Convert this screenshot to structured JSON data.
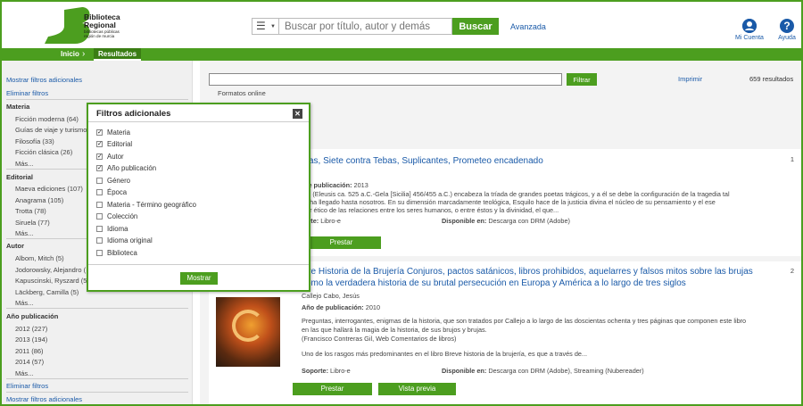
{
  "header": {
    "logo_title_1": "Biblioteca",
    "logo_title_2": "Regional",
    "logo_sub_1": "bibliotecas públicas",
    "logo_sub_2": "región de murcia",
    "search_placeholder": "Buscar por título, autor y demás",
    "search_button": "Buscar",
    "advanced_link": "Avanzada",
    "account_label": "Mi Cuenta",
    "help_label": "Ayuda"
  },
  "nav": {
    "home": "Inicio",
    "results": "Resultados"
  },
  "sidebar": {
    "more_filters_top": "Mostrar filtros adicionales",
    "remove_filters_top": "Eliminar filtros",
    "sections": [
      {
        "heading": "Materia",
        "items": [
          "Ficción moderna (64)",
          "Guías de viaje y turismo",
          "Filosofía (33)",
          "Ficción clásica (26)",
          "Más..."
        ]
      },
      {
        "heading": "Editorial",
        "items": [
          "Maeva ediciones (107)",
          "Anagrama (105)",
          "Trotta (78)",
          "Siruela (77)",
          "Más..."
        ]
      },
      {
        "heading": "Autor",
        "items": [
          "Albom, Mitch (5)",
          "Jodorowsky, Alejandro (",
          "Kapuscinski, Ryszard (5",
          "Läckberg, Camilla (5)",
          "Más..."
        ]
      },
      {
        "heading": "Año publicación",
        "items": [
          "2012 (227)",
          "2013 (194)",
          "2011 (86)",
          "2014 (57)",
          "Más..."
        ]
      }
    ],
    "remove_filters_bottom": "Eliminar filtros",
    "more_filters_bottom": "Mostrar filtros adicionales"
  },
  "main": {
    "filter_button": "Filtrar",
    "print_link": "Imprimir",
    "results_count": "659 resultados",
    "formats_label": "Formatos online",
    "results": [
      {
        "number": "1",
        "title": "sas, Siete contra Tebas, Suplicantes, Prometeo encadenado",
        "author": "ilo",
        "year_label": "de publicación:",
        "year": "2013",
        "desc_1": "ilo (Eleusis ca. 525 a.C.-Gela [Sicilia] 456/455 a.C.) encabeza la tríada de grandes poetas trágicos, y a él se debe la configuración de la tragedia tal",
        "desc_2": "a ha llegado hasta nosotros. En su dimensión marcadamente teológica, Esquilo hace de la justicia divina el núcleo de su pensamiento y el ese",
        "desc_3": "ter ético de las relaciones entre los seres humanos, o entre éstos y la divinidad, el que...",
        "support_label": "orte:",
        "support": "Libro-e",
        "avail_label": "Disponible en:",
        "avail": "Descarga con DRM (Adobe)",
        "borrow": "Prestar"
      },
      {
        "number": "2",
        "title_1": "eve Historia de la Brujería Conjuros, pactos satánicos, libros prohibidos, aquelarres y falsos mitos sobre las brujas",
        "title_2": "como la verdadera historia de su brutal persecución en Europa y América a lo largo de tres siglos",
        "author": "Callejo Cabo, Jesús",
        "year_label": "Año de publicación:",
        "year": "2010",
        "desc_1": "Preguntas, interrogantes, enigmas de la historia, que son tratados por Callejo a lo largo de las doscientas ochenta y tres páginas que componen este libro",
        "desc_2": "en las que hallará la magia de la historia, de sus brujos y brujas.",
        "desc_3": "(Francisco Contreras Gil, Web Comentarios de libros)",
        "desc_4": "Uno de los rasgos más predominantes en el libro Breve historia de la brujería, es que a través de...",
        "support_label": "Soporte:",
        "support": "Libro-e",
        "avail_label": "Disponible en:",
        "avail": "Descarga con DRM (Adobe), Streaming (Nubereader)",
        "borrow": "Prestar",
        "preview": "Vista previa"
      }
    ]
  },
  "modal": {
    "title": "Filtros adicionales",
    "close": "✕",
    "options": [
      {
        "label": "Materia",
        "checked": true
      },
      {
        "label": "Editorial",
        "checked": true
      },
      {
        "label": "Autor",
        "checked": true
      },
      {
        "label": "Año publicación",
        "checked": true
      },
      {
        "label": "Género",
        "checked": false
      },
      {
        "label": "Época",
        "checked": false
      },
      {
        "label": "Materia - Término geográfico",
        "checked": false
      },
      {
        "label": "Colección",
        "checked": false
      },
      {
        "label": "Idioma",
        "checked": false
      },
      {
        "label": "Idioma original",
        "checked": false
      },
      {
        "label": "Biblioteca",
        "checked": false
      }
    ],
    "show_button": "Mostrar"
  },
  "colors": {
    "accent": "#4c9e1f",
    "link": "#1a5aa8"
  }
}
